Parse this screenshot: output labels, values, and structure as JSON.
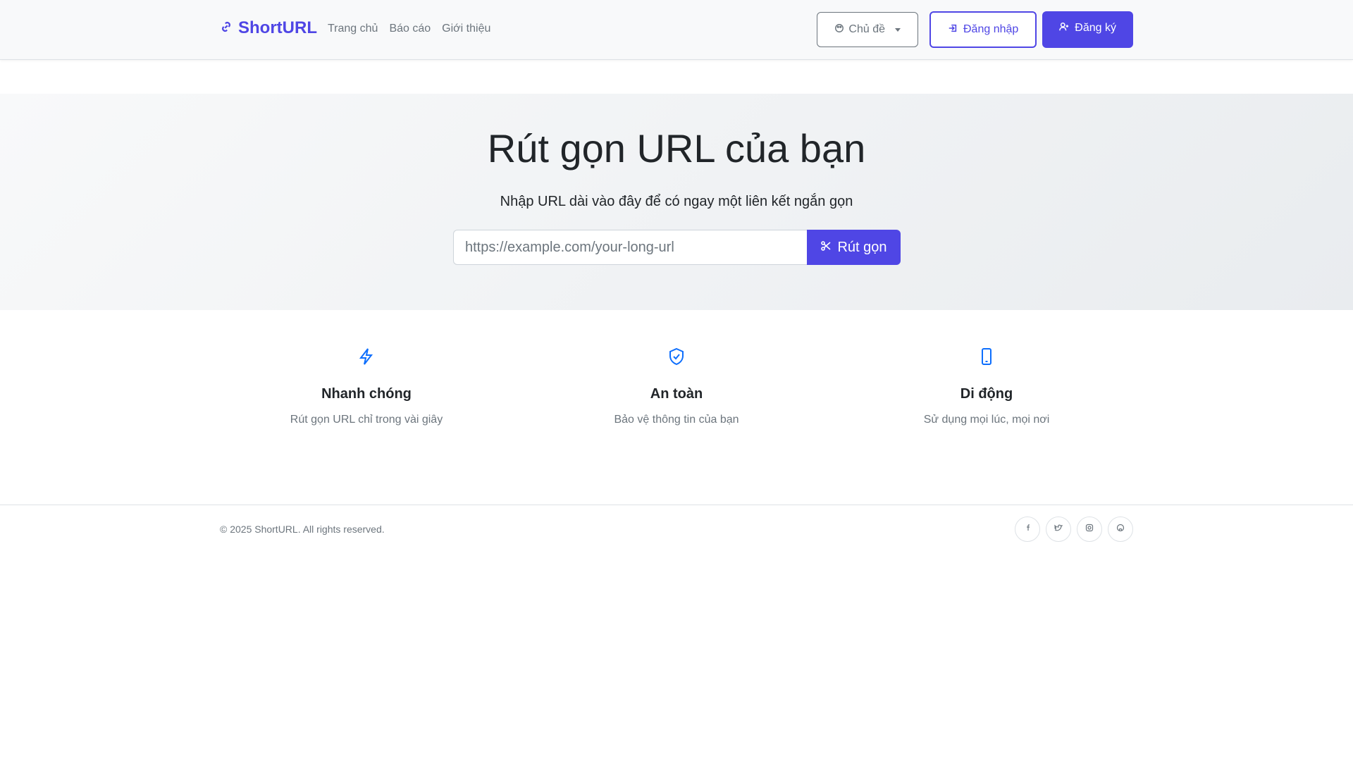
{
  "brand": {
    "name": "ShortURL",
    "icon": "link-icon"
  },
  "nav": {
    "links": [
      {
        "label": "Trang chủ"
      },
      {
        "label": "Báo cáo"
      },
      {
        "label": "Giới thiệu"
      }
    ],
    "theme_label": "Chủ đề",
    "login_label": "Đăng nhập",
    "signup_label": "Đăng ký"
  },
  "hero": {
    "title": "Rút gọn URL của bạn",
    "subtitle": "Nhập URL dài vào đây để có ngay một liên kết ngắn gọn",
    "input_placeholder": "https://example.com/your-long-url",
    "input_value": "",
    "submit_label": "Rút gọn"
  },
  "features": [
    {
      "icon": "bolt-icon",
      "title": "Nhanh chóng",
      "desc": "Rút gọn URL chỉ trong vài giây"
    },
    {
      "icon": "shield-icon",
      "title": "An toàn",
      "desc": "Bảo vệ thông tin của bạn"
    },
    {
      "icon": "mobile-icon",
      "title": "Di động",
      "desc": "Sử dụng mọi lúc, mọi nơi"
    }
  ],
  "footer": {
    "copyright": "© 2025 ShortURL. All rights reserved.",
    "socials": [
      "facebook-icon",
      "twitter-icon",
      "instagram-icon",
      "github-icon"
    ]
  },
  "colors": {
    "accent": "#4f46e5",
    "muted_text": "#6c757d",
    "feature_icon": "#0d6efd"
  }
}
